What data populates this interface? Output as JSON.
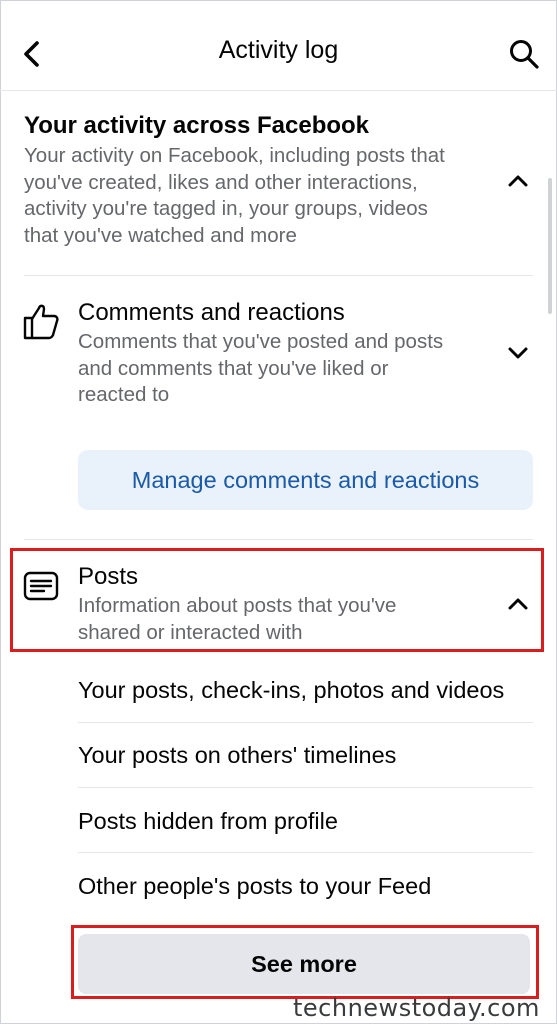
{
  "header": {
    "title": "Activity log",
    "back_icon": "chevron-left-icon",
    "search_icon": "search-icon"
  },
  "activity_section": {
    "title": "Your activity across Facebook",
    "description_lines": [
      "Your activity on Facebook, including posts that",
      "you've created, likes and other interactions,",
      "activity you're tagged in, your groups, videos",
      "that you've watched and more"
    ],
    "state_icon": "chevron-up-icon"
  },
  "comments_section": {
    "icon": "thumbs-up-icon",
    "title": "Comments and reactions",
    "description_lines": [
      "Comments that you've posted and posts",
      "and comments that you've liked or",
      "reacted to"
    ],
    "state_icon": "chevron-down-icon",
    "manage_button": "Manage comments and reactions"
  },
  "posts_section": {
    "icon": "posts-icon",
    "title": "Posts",
    "description_lines": [
      "Information about posts that you've",
      "shared or interacted with"
    ],
    "state_icon": "chevron-up-icon",
    "items": [
      "Your posts, check-ins, photos and videos",
      "Your posts on others' timelines",
      "Posts hidden from profile",
      "Other people's posts to your Feed"
    ],
    "see_more": "See more"
  },
  "watermark": "technewstoday.com",
  "colors": {
    "link_blue": "#1a5aa6",
    "secondary_text": "#65676b",
    "highlight_red": "#d81e1e",
    "manage_bg": "#e9f1fb",
    "see_more_bg": "#e4e6eb"
  }
}
